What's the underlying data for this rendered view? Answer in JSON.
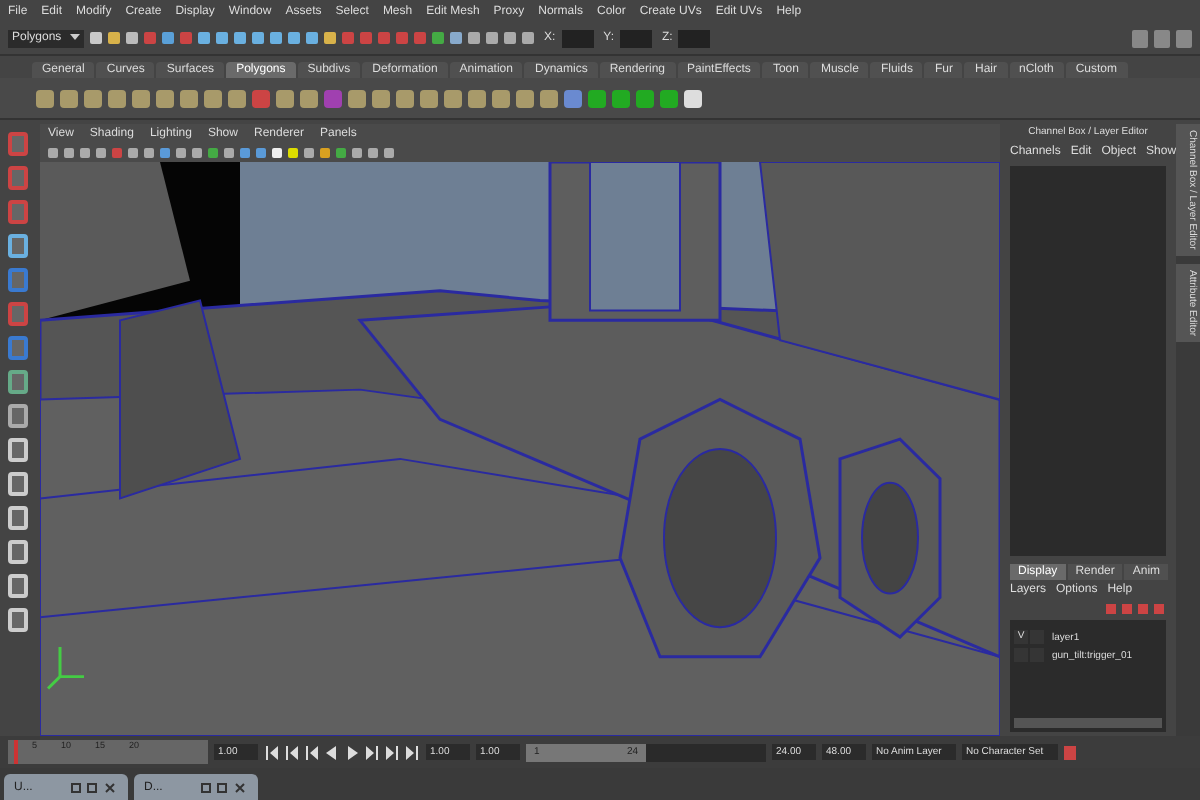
{
  "menu_bar": [
    "File",
    "Edit",
    "Modify",
    "Create",
    "Display",
    "Window",
    "Assets",
    "Select",
    "Mesh",
    "Edit Mesh",
    "Proxy",
    "Normals",
    "Color",
    "Create UVs",
    "Edit UVs",
    "Help"
  ],
  "status_line": {
    "mode": "Polygons",
    "fields": [
      {
        "label": "X:"
      },
      {
        "label": "Y:"
      },
      {
        "label": "Z:"
      }
    ]
  },
  "shelf": {
    "tabs": [
      {
        "label": "General",
        "selected": false
      },
      {
        "label": "Curves",
        "selected": false
      },
      {
        "label": "Surfaces",
        "selected": false
      },
      {
        "label": "Polygons",
        "selected": true
      },
      {
        "label": "Subdivs",
        "selected": false
      },
      {
        "label": "Deformation",
        "selected": false
      },
      {
        "label": "Animation",
        "selected": false
      },
      {
        "label": "Dynamics",
        "selected": false
      },
      {
        "label": "Rendering",
        "selected": false
      },
      {
        "label": "PaintEffects",
        "selected": false
      },
      {
        "label": "Toon",
        "selected": false
      },
      {
        "label": "Muscle",
        "selected": false
      },
      {
        "label": "Fluids",
        "selected": false
      },
      {
        "label": "Fur",
        "selected": false
      },
      {
        "label": "Hair",
        "selected": false
      },
      {
        "label": "nCloth",
        "selected": false
      },
      {
        "label": "Custom",
        "selected": false
      }
    ]
  },
  "viewport": {
    "menu": [
      "View",
      "Shading",
      "Lighting",
      "Show",
      "Renderer",
      "Panels"
    ]
  },
  "channel_box": {
    "title": "Channel Box / Layer Editor",
    "menu": [
      "Channels",
      "Edit",
      "Object",
      "Show"
    ]
  },
  "layer_editor": {
    "tabs": [
      {
        "label": "Display",
        "selected": true
      },
      {
        "label": "Render",
        "selected": false
      },
      {
        "label": "Anim",
        "selected": false
      }
    ],
    "menu": [
      "Layers",
      "Options",
      "Help"
    ],
    "layers": [
      {
        "visibility": "V",
        "name": "layer1"
      },
      {
        "name": "gun_tilt:trigger_01"
      }
    ]
  },
  "side_tabs": [
    "Channel Box / Layer Editor",
    "Attribute Editor"
  ],
  "time_slider": {
    "ticks": [
      "5",
      "10",
      "15",
      "20"
    ],
    "current_time": "1.00",
    "level": 0.03
  },
  "range_slider": {
    "start": "1.00",
    "playback_start": "1.00",
    "handle_start": "1",
    "handle_end": "24",
    "level": 0.5,
    "playback_end": "24.00",
    "end": "48.00"
  },
  "anim_layer": "No Anim Layer",
  "character_set": "No Character Set",
  "taskbar": [
    {
      "label": "U..."
    },
    {
      "label": "D..."
    }
  ]
}
